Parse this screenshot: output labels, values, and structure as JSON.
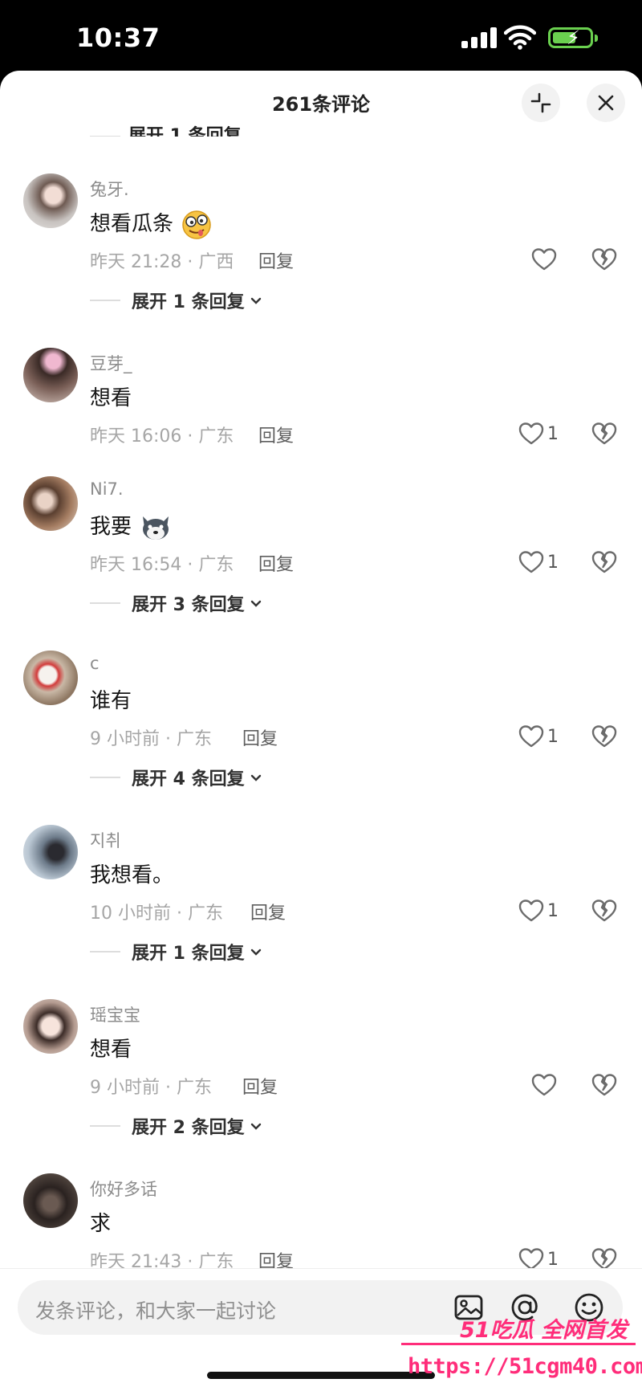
{
  "status_bar": {
    "time": "10:37"
  },
  "header": {
    "title": "261条评论"
  },
  "partial_expand_label": "展开 1 条回复",
  "comments": [
    {
      "name": "兔牙.",
      "text": "想看瓜条",
      "emoji": "drooling-face-emoji",
      "meta": "昨天 21:28 · 广西",
      "reply_label": "回复",
      "likes": "",
      "expand": "展开 1 条回复"
    },
    {
      "name": "豆芽_",
      "text": "想看",
      "emoji": "",
      "meta": "昨天 16:06 · 广东",
      "reply_label": "回复",
      "likes": "1",
      "expand": ""
    },
    {
      "name": "Ni7.",
      "text": "我要",
      "emoji": "husky-emoji",
      "meta": "昨天 16:54 · 广东",
      "reply_label": "回复",
      "likes": "1",
      "expand": "展开 3 条回复"
    },
    {
      "name": "c",
      "text": "谁有",
      "emoji": "",
      "meta": "9 小时前 · 广东",
      "reply_label": "回复",
      "likes": "1",
      "expand": "展开 4 条回复"
    },
    {
      "name": "지취",
      "text": "我想看。",
      "emoji": "",
      "meta": "10 小时前 · 广东",
      "reply_label": "回复",
      "likes": "1",
      "expand": "展开 1 条回复"
    },
    {
      "name": "瑶宝宝",
      "text": "想看",
      "emoji": "",
      "meta": "9 小时前 · 广东",
      "reply_label": "回复",
      "likes": "",
      "expand": "展开 2 条回复"
    },
    {
      "name": "你好多话",
      "text": "求",
      "emoji": "",
      "meta": "昨天 21:43 · 广东",
      "reply_label": "回复",
      "likes": "1",
      "expand": ""
    }
  ],
  "input": {
    "placeholder": "发条评论，和大家一起讨论"
  },
  "icons": {
    "collapse": "collapse-icon",
    "close": "close-icon",
    "like": "heart-icon",
    "dislike": "broken-heart-icon",
    "chevron": "chevron-down-icon",
    "image": "image-icon",
    "mention": "at-icon",
    "emoji": "smiley-icon"
  },
  "watermark": {
    "tagline": "51吃瓜 全网首发",
    "url": "https://51cgm40.com"
  },
  "colors": {
    "accent_watermark": "#ff2d7a",
    "battery": "#6ad04f"
  }
}
